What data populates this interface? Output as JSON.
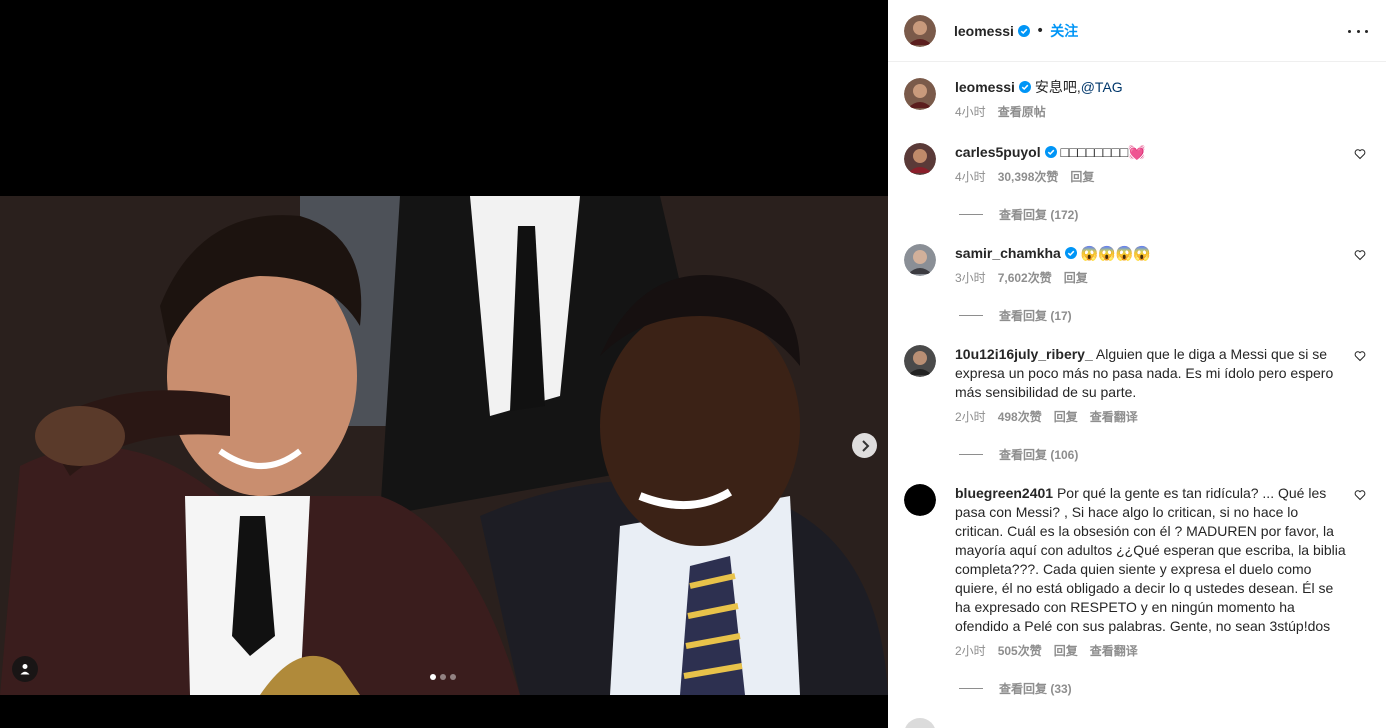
{
  "post": {
    "username": "leomessi",
    "separator": "•",
    "follow_label": "关注",
    "caption": "安息吧,",
    "caption_mention": "@TAG",
    "time": "4小时",
    "see_original": "查看原帖"
  },
  "carousel": {
    "total": 3,
    "current": 1
  },
  "icons": {
    "verified": "verified-badge-icon",
    "heart": "heart-icon",
    "more": "more-options-icon",
    "next": "chevron-right-icon",
    "tag": "user-tag-icon"
  },
  "colors": {
    "accent": "#0095f6",
    "text": "#262626",
    "muted": "#8e8e8e"
  },
  "comments": [
    {
      "user": "carles5puyol",
      "verified": true,
      "text": "□□□□□□□□💓",
      "time": "4小时",
      "likes": "30,398次赞",
      "reply": "回复",
      "translate": "",
      "view_replies": "查看回复 (172)"
    },
    {
      "user": "samir_chamkha",
      "verified": true,
      "text": "😱😱😱😱",
      "time": "3小时",
      "likes": "7,602次赞",
      "reply": "回复",
      "translate": "",
      "view_replies": "查看回复 (17)"
    },
    {
      "user": "10u12i16july_ribery_",
      "verified": false,
      "text": "Alguien que le diga a Messi que si se expresa un poco más no pasa nada. Es mi ídolo pero espero más sensibilidad de su parte.",
      "time": "2小时",
      "likes": "498次赞",
      "reply": "回复",
      "translate": "查看翻译",
      "view_replies": "查看回复 (106)"
    },
    {
      "user": "bluegreen2401",
      "verified": false,
      "text": "Por qué la gente es tan ridícula? ... Qué les pasa con Messi? , Si hace algo lo critican, si no hace lo critican. Cuál es la obsesión con él ? MADUREN por favor, la mayoría aquí con adultos ¿¿Qué esperan que escriba, la biblia completa???. Cada quien siente y expresa el duelo como quiere, él no está obligado a decir lo q ustedes desean. Él se ha expresado con RESPETO y en ningún momento ha ofendido a Pelé con sus palabras. Gente, no sean 3stúp!dos",
      "time": "2小时",
      "likes": "505次赞",
      "reply": "回复",
      "translate": "查看翻译",
      "view_replies": "查看回复 (33)"
    }
  ]
}
